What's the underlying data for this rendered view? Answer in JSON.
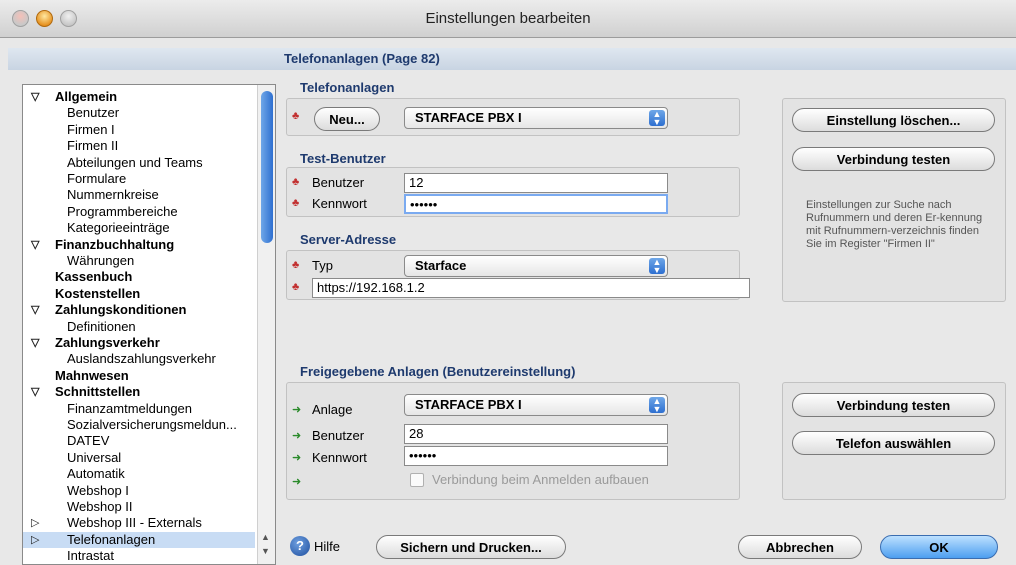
{
  "window": {
    "title": "Einstellungen bearbeiten"
  },
  "page": {
    "title": "Telefonanlagen (Page 82)"
  },
  "sidebar": {
    "items": [
      {
        "label": "Allgemein",
        "level": 0,
        "bold": true,
        "expanded": true
      },
      {
        "label": "Benutzer",
        "level": 1
      },
      {
        "label": "Firmen I",
        "level": 1
      },
      {
        "label": "Firmen II",
        "level": 1
      },
      {
        "label": "Abteilungen und Teams",
        "level": 1
      },
      {
        "label": "Formulare",
        "level": 1
      },
      {
        "label": "Nummernkreise",
        "level": 1
      },
      {
        "label": "Programmbereiche",
        "level": 1
      },
      {
        "label": "Kategorieeinträge",
        "level": 1
      },
      {
        "label": "Finanzbuchhaltung",
        "level": 0,
        "bold": true,
        "expanded": true
      },
      {
        "label": "Währungen",
        "level": 1
      },
      {
        "label": "Kassenbuch",
        "level": 0,
        "bold": true
      },
      {
        "label": "Kostenstellen",
        "level": 0,
        "bold": true
      },
      {
        "label": "Zahlungskonditionen",
        "level": 0,
        "bold": true,
        "expanded": true
      },
      {
        "label": "Definitionen",
        "level": 1
      },
      {
        "label": "Zahlungsverkehr",
        "level": 0,
        "bold": true,
        "expanded": true
      },
      {
        "label": "Auslandszahlungsverkehr",
        "level": 1
      },
      {
        "label": "Mahnwesen",
        "level": 0,
        "bold": true
      },
      {
        "label": "Schnittstellen",
        "level": 0,
        "bold": true,
        "expanded": true
      },
      {
        "label": "Finanzamtmeldungen",
        "level": 1
      },
      {
        "label": "Sozialversicherungsmeldun...",
        "level": 1
      },
      {
        "label": "DATEV",
        "level": 1
      },
      {
        "label": "Universal",
        "level": 1
      },
      {
        "label": "Automatik",
        "level": 1
      },
      {
        "label": "Webshop I",
        "level": 1
      },
      {
        "label": "Webshop II",
        "level": 1
      },
      {
        "label": "Webshop III - Externals",
        "level": 1,
        "collapsed": true
      },
      {
        "label": "Telefonanlagen",
        "level": 1,
        "collapsed": true,
        "selected": true
      },
      {
        "label": "Intrastat",
        "level": 1
      }
    ]
  },
  "telefonanlagen": {
    "section_title": "Telefonanlagen",
    "new_button": "Neu...",
    "selected_pbx": "STARFACE PBX I"
  },
  "test_user": {
    "section_title": "Test-Benutzer",
    "user_label": "Benutzer",
    "user_value": "12",
    "password_label": "Kennwort",
    "password_value": "••••••"
  },
  "server": {
    "section_title": "Server-Adresse",
    "type_label": "Typ",
    "type_value": "Starface",
    "url_value": "https://192.168.1.2"
  },
  "right_panel": {
    "delete_button": "Einstellung löschen...",
    "test_button": "Verbindung testen",
    "info_text": "Einstellungen zur Suche nach Rufnummern und deren Er-kennung mit Rufnummern-verzeichnis finden Sie im Register \"Firmen II\""
  },
  "shared": {
    "section_title": "Freigegebene Anlagen (Benutzereinstellung)",
    "anlage_label": "Anlage",
    "anlage_value": "STARFACE PBX I",
    "user_label": "Benutzer",
    "user_value": "28",
    "password_label": "Kennwort",
    "password_value": "••••••",
    "connect_label": "Verbindung beim Anmelden aufbauen",
    "connect_checked": false,
    "test_button": "Verbindung testen",
    "phone_button": "Telefon auswählen"
  },
  "footer": {
    "help_label": "Hilfe",
    "save_print_button": "Sichern und Drucken...",
    "cancel_button": "Abbrechen",
    "ok_button": "OK"
  },
  "colors": {
    "section_title": "#1e3a6e",
    "selection": "#c8dcf4",
    "ok_button": "#4d9ef0"
  }
}
